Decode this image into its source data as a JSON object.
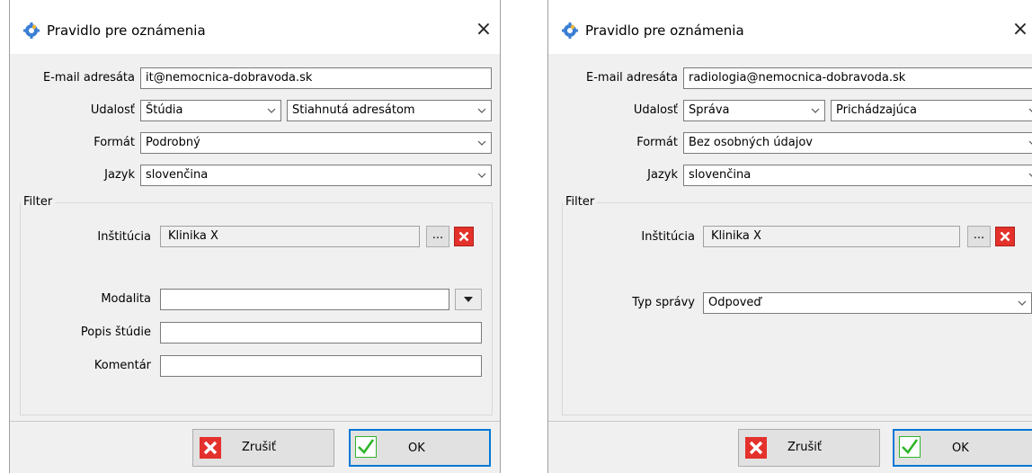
{
  "dialog_a": {
    "title": "Pravidlo pre oznámenia",
    "close_glyph": "×",
    "email": {
      "label": "E-mail adresáta",
      "value": "it@nemocnica-dobravoda.sk"
    },
    "event": {
      "label": "Udalosť",
      "value1": "Štúdia",
      "value2": "Stiahnutá adresátom"
    },
    "format": {
      "label": "Formát",
      "value": "Podrobný"
    },
    "language": {
      "label": "Jazyk",
      "value": "slovenčina"
    },
    "filter": {
      "label": "Filter",
      "institution": {
        "label": "Inštitúcia",
        "value": "Klinika X",
        "browse_label": "..."
      },
      "modality": {
        "label": "Modalita",
        "value": ""
      },
      "study_description": {
        "label": "Popis štúdie",
        "value": ""
      },
      "comment": {
        "label": "Komentár",
        "value": ""
      }
    },
    "cancel_label": "Zrušiť",
    "ok_label": "OK"
  },
  "dialog_b": {
    "title": "Pravidlo pre oznámenia",
    "close_glyph": "×",
    "email": {
      "label": "E-mail adresáta",
      "value": "radiologia@nemocnica-dobravoda.sk"
    },
    "event": {
      "label": "Udalosť",
      "value1": "Správa",
      "value2": "Prichádzajúca"
    },
    "format": {
      "label": "Formát",
      "value": "Bez osobných údajov"
    },
    "language": {
      "label": "Jazyk",
      "value": "slovenčina"
    },
    "filter": {
      "label": "Filter",
      "institution": {
        "label": "Inštitúcia",
        "value": "Klinika X",
        "browse_label": "..."
      },
      "report_type": {
        "label": "Typ správy",
        "value": "Odpoveď"
      }
    },
    "cancel_label": "Zrušiť",
    "ok_label": "OK"
  },
  "icons": {
    "window": "gear-icon",
    "close": "close-icon",
    "combo": "chevron-down-icon",
    "clear": "clear-x-icon",
    "cancel": "cancel-x-icon",
    "ok": "checkmark-icon"
  },
  "colors": {
    "dialog_bg": "#f0f0f0",
    "title_bg": "#ffffff",
    "accent": "#0078d7",
    "danger": "#e4312b",
    "ok_green": "#2fb52a"
  }
}
